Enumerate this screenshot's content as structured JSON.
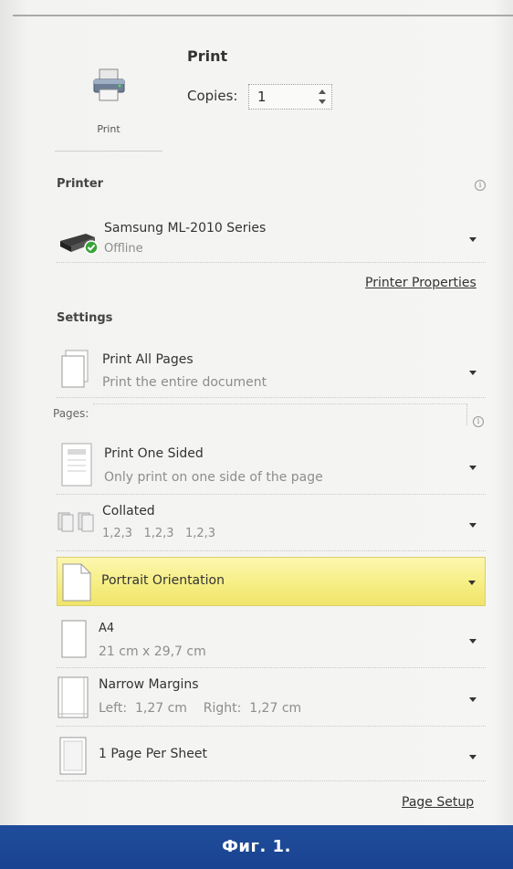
{
  "print": {
    "button_label": "Print",
    "heading": "Print",
    "copies_label": "Copies:",
    "copies_value": "1"
  },
  "printer": {
    "heading": "Printer",
    "name": "Samsung ML-2010 Series",
    "status": "Offline",
    "properties_link": "Printer Properties"
  },
  "settings": {
    "heading": "Settings",
    "print_range": {
      "title": "Print All Pages",
      "sub": "Print the entire document"
    },
    "pages_label": "Pages:",
    "sides": {
      "title": "Print One Sided",
      "sub": "Only print on one side of the page"
    },
    "collation": {
      "title": "Collated",
      "sub": "1,2,3   1,2,3   1,2,3"
    },
    "orientation": {
      "title": "Portrait Orientation"
    },
    "paper": {
      "title": "A4",
      "sub": "21 cm x 29,7 cm"
    },
    "margins": {
      "title": "Narrow Margins",
      "sub": "Left:  1,27 cm    Right:  1,27 cm"
    },
    "per_sheet": {
      "title": "1 Page Per Sheet"
    },
    "page_setup_link": "Page Setup"
  },
  "caption": "Фиг. 1.",
  "colors": {
    "highlight": "#f6ee84",
    "footer": "#1f4d9b",
    "status_ok": "#3aa23a"
  }
}
